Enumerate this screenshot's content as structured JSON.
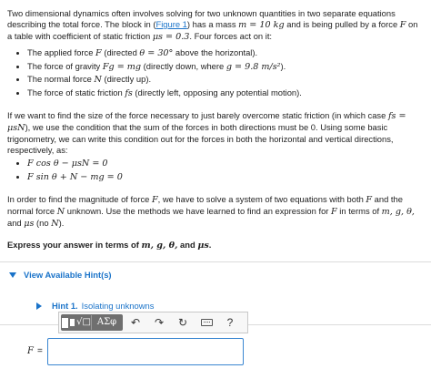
{
  "problem": {
    "intro_1": "Two dimensional dynamics often involves solving for two unknown quantities in two separate equations describing the total force. The block in (",
    "figure_link": "Figure 1",
    "intro_2": ") has a mass ",
    "mass_expr": "m = 10 kg",
    "intro_3": " and is being pulled by a force ",
    "force_var": "F",
    "intro_4": " on a table with coefficient of static friction ",
    "mu_expr": "μs = 0.3",
    "intro_5": ". Four forces act on it:",
    "forces": [
      {
        "pre": "The applied force ",
        "var": "F",
        "post": " (directed ",
        "expr": "θ = 30°",
        "end": " above the horizontal)."
      },
      {
        "pre": "The force of gravity ",
        "var": "Fg = mg",
        "post": " (directly down, where ",
        "expr": "g = 9.8 m/s²",
        "end": ")."
      },
      {
        "pre": "The normal force ",
        "var": "N",
        "post": " (directly up).",
        "expr": "",
        "end": ""
      },
      {
        "pre": "The force of static friction ",
        "var": "fs",
        "post": " (directly left, opposing any potential motion).",
        "expr": "",
        "end": ""
      }
    ],
    "para2_1": "If we want to find the size of the force necessary to just barely overcome static friction (in which case ",
    "para2_expr": "fs = μsN",
    "para2_2": "), we use the condition that the sum of the forces in both directions must be 0. Using some basic trigonometry, we can write this condition out for the forces in both the horizontal and vertical directions, respectively, as:",
    "equations": [
      "F cos θ − μsN = 0",
      "F sin θ + N − mg = 0"
    ],
    "para3_1": "In order to find the magnitude of force ",
    "para3_var": "F",
    "para3_2": ", we have to solve a system of two equations with both ",
    "para3_var2": "F",
    "para3_3": " and the normal force ",
    "para3_var3": "N",
    "para3_4": " unknown. Use the methods we have learned to find an expression for ",
    "para3_var4": "F",
    "para3_5": " in terms of ",
    "para3_vars": "m, g, θ,",
    "para3_6": " and ",
    "para3_mu": "μs",
    "para3_7": " (no ",
    "para3_var5": "N",
    "para3_8": ").",
    "express_1": "Express your answer in terms of ",
    "express_vars": "m, g, θ,",
    "express_2": " and ",
    "express_mu": "μs",
    "express_3": "."
  },
  "hints": {
    "toggle_label": "View Available Hint(s)",
    "hint1_number": "Hint 1.",
    "hint1_title": "Isolating unknowns"
  },
  "toolbar": {
    "template_label": "√□",
    "greek_label": "ΑΣφ",
    "undo_icon": "↶",
    "redo_icon": "↷",
    "reset_icon": "↻",
    "help_label": "?"
  },
  "answer": {
    "label": "F",
    "equals": "=",
    "value": ""
  },
  "colors": {
    "link": "#1a73c9",
    "toolbar_dark": "#6f6f6f",
    "input_border": "#3a86d1"
  }
}
